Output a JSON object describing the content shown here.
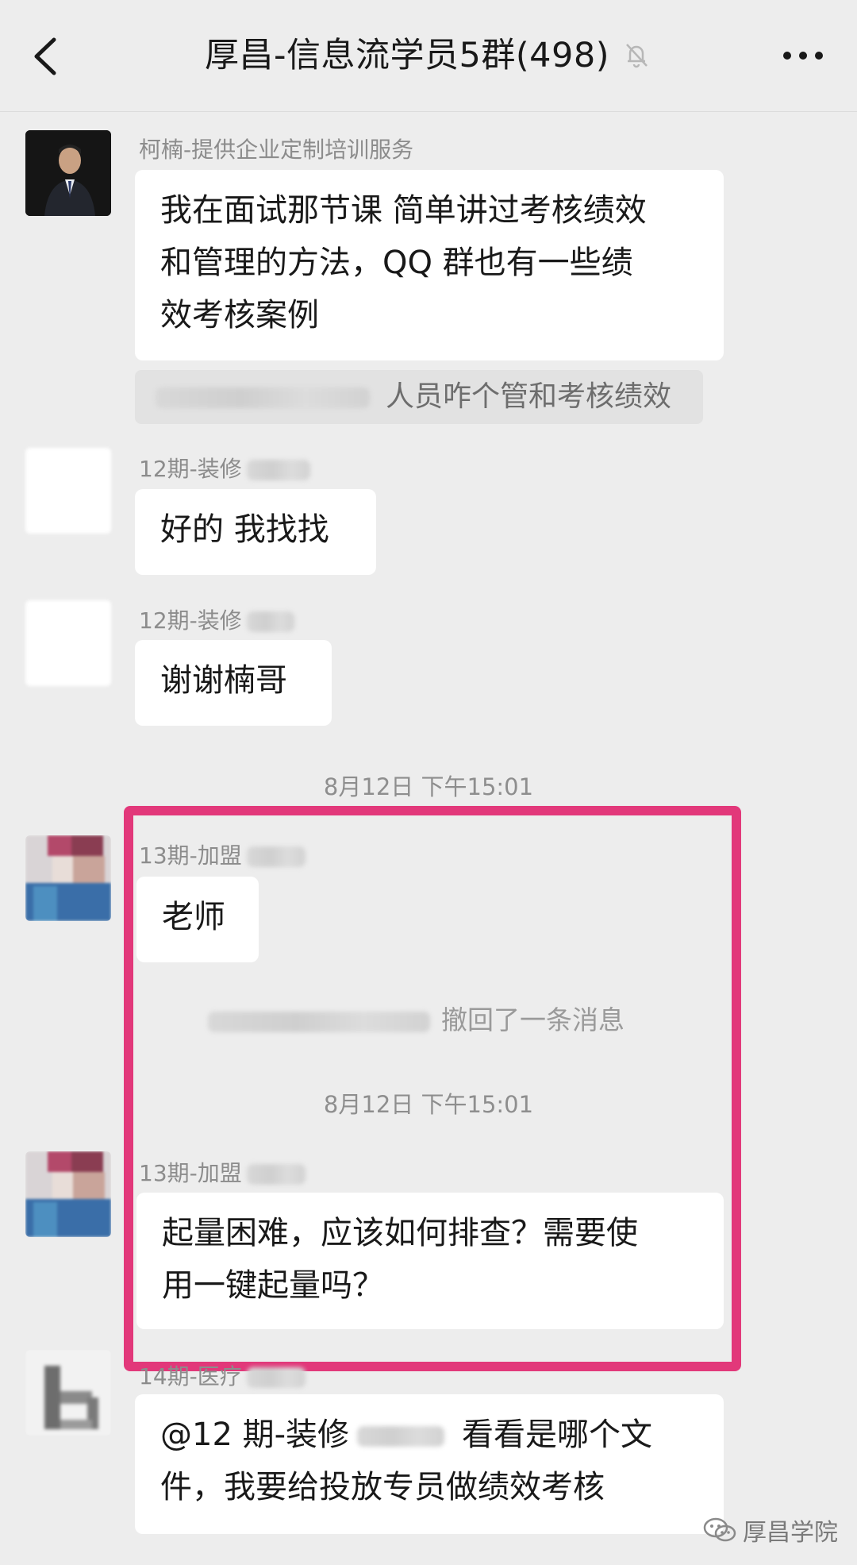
{
  "header": {
    "title": "厚昌-信息流学员5群(498)",
    "back_icon": "chevron-left-icon",
    "mute_icon": "bell-off-icon",
    "more_icon": "more-dots-icon"
  },
  "messages": [
    {
      "sender": "柯楠-提供企业定制培训服务",
      "lines": [
        "我在面试那节课 简单讲过考核绩效",
        "和管理的方法，QQ 群也有一些绩",
        "效考核案例"
      ],
      "quote": "人员咋个管和考核绩效"
    },
    {
      "sender": "12期-装修",
      "text": "好的 我找找"
    },
    {
      "sender": "12期-装修",
      "text": "谢谢楠哥"
    },
    {
      "time": "8月12日 下午15:01"
    },
    {
      "sender": "13期-加盟",
      "text": "老师"
    },
    {
      "system": "撤回了一条消息"
    },
    {
      "time": "8月12日 下午15:01"
    },
    {
      "sender": "13期-加盟",
      "lines": [
        "起量困难，应该如何排查？需要使",
        "用一键起量吗？"
      ]
    },
    {
      "sender": "14期-医疗",
      "lines_a": "@12 期-装修",
      "lines_a2": "看看是哪个文",
      "lines_b": "件，我要给投放专员做绩效考核"
    }
  ],
  "watermark": {
    "text": "厚昌学院",
    "icon": "wechat-icon"
  },
  "colors": {
    "highlight": "#e2387a",
    "bg": "#ededed",
    "bubble": "#ffffff"
  }
}
